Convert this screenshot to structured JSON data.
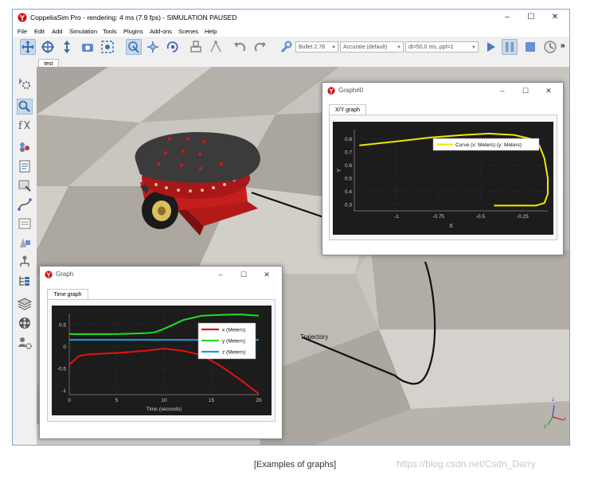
{
  "app": {
    "title": "CoppeliaSim Pro - rendering: 4 ms (7.9 fps) - SIMULATION PAUSED",
    "window_controls": {
      "minimize": "–",
      "maximize": "☐",
      "close": "✕"
    },
    "menu": [
      "File",
      "Edit",
      "Add",
      "Simulation",
      "Tools",
      "Plugins",
      "Add-ons",
      "Scenes",
      "Help"
    ],
    "toolbar": {
      "engine": "Bullet 2.78",
      "accuracy": "Accurate (default)",
      "timestep": "dt=50.0 ms, ppf=1",
      "overflow": "»"
    },
    "scene_tab": "test",
    "scene_label": "Trajectory",
    "axes_gizmo": {
      "x": "x",
      "y": "y",
      "z": "z"
    }
  },
  "colors": {
    "x_series": "#e81010",
    "y_series": "#22dd22",
    "z_series": "#1e9ce0",
    "xy_curve": "#f0e800",
    "plot_bg": "#1c1c1c"
  },
  "graph_xy": {
    "title": "Graph#0",
    "tab": "X/Y graph",
    "legend": "Curve (x: Meters) (y: Meters)",
    "xlabel": "X",
    "ylabel": "Y",
    "xticks": [
      "-1",
      "-0.75",
      "-0.5",
      "-0.25"
    ],
    "yticks": [
      "0.8",
      "0.7",
      "0.6",
      "0.5",
      "0.4",
      "0.3"
    ]
  },
  "graph_time": {
    "title": "Graph",
    "tab": "Time graph",
    "xlabel": "Time (seconds)",
    "xticks": [
      "0",
      "5",
      "10",
      "15",
      "20"
    ],
    "yticks": [
      "0.5",
      "0",
      "-0.5",
      "-1"
    ],
    "legend": [
      "x (Meters)",
      "y (Meters)",
      "z (Meters)"
    ]
  },
  "caption": "[Examples of graphs]",
  "watermark": "https://blog.csdn.net/Csdn_Darry",
  "chart_data": [
    {
      "type": "line",
      "title": "",
      "xlabel": "X",
      "ylabel": "Y",
      "xlim": [
        -1.25,
        -0.1
      ],
      "ylim": [
        0.25,
        0.87
      ],
      "series": [
        {
          "name": "Curve (x: Meters) (y: Meters)",
          "x": [
            -1.22,
            -1.0,
            -0.8,
            -0.6,
            -0.45,
            -0.3,
            -0.2,
            -0.15,
            -0.12,
            -0.1,
            -0.1,
            -0.12,
            -0.17,
            -0.25,
            -0.35,
            -0.42
          ],
          "y": [
            0.75,
            0.78,
            0.81,
            0.83,
            0.84,
            0.83,
            0.8,
            0.75,
            0.65,
            0.5,
            0.38,
            0.31,
            0.29,
            0.29,
            0.29,
            0.29
          ]
        }
      ],
      "legend": "top-right",
      "grid": true
    },
    {
      "type": "line",
      "title": "",
      "xlabel": "Time (seconds)",
      "ylabel": "",
      "xlim": [
        0,
        20
      ],
      "ylim": [
        -1.1,
        0.75
      ],
      "series": [
        {
          "name": "x (Meters)",
          "x": [
            0,
            1,
            2,
            5,
            8,
            10,
            12,
            14,
            16,
            18,
            20
          ],
          "y": [
            -0.42,
            -0.22,
            -0.18,
            -0.15,
            -0.1,
            -0.05,
            -0.1,
            -0.2,
            -0.45,
            -0.75,
            -1.08
          ]
        },
        {
          "name": "y (Meters)",
          "x": [
            0,
            2,
            5,
            8,
            9,
            10,
            12,
            14,
            16,
            18,
            20
          ],
          "y": [
            0.28,
            0.28,
            0.28,
            0.3,
            0.32,
            0.4,
            0.6,
            0.7,
            0.72,
            0.73,
            0.7
          ]
        },
        {
          "name": "z (Meters)",
          "x": [
            0,
            5,
            10,
            15,
            20
          ],
          "y": [
            0.15,
            0.15,
            0.15,
            0.15,
            0.15
          ]
        }
      ],
      "legend": "top-right",
      "grid": true
    }
  ]
}
